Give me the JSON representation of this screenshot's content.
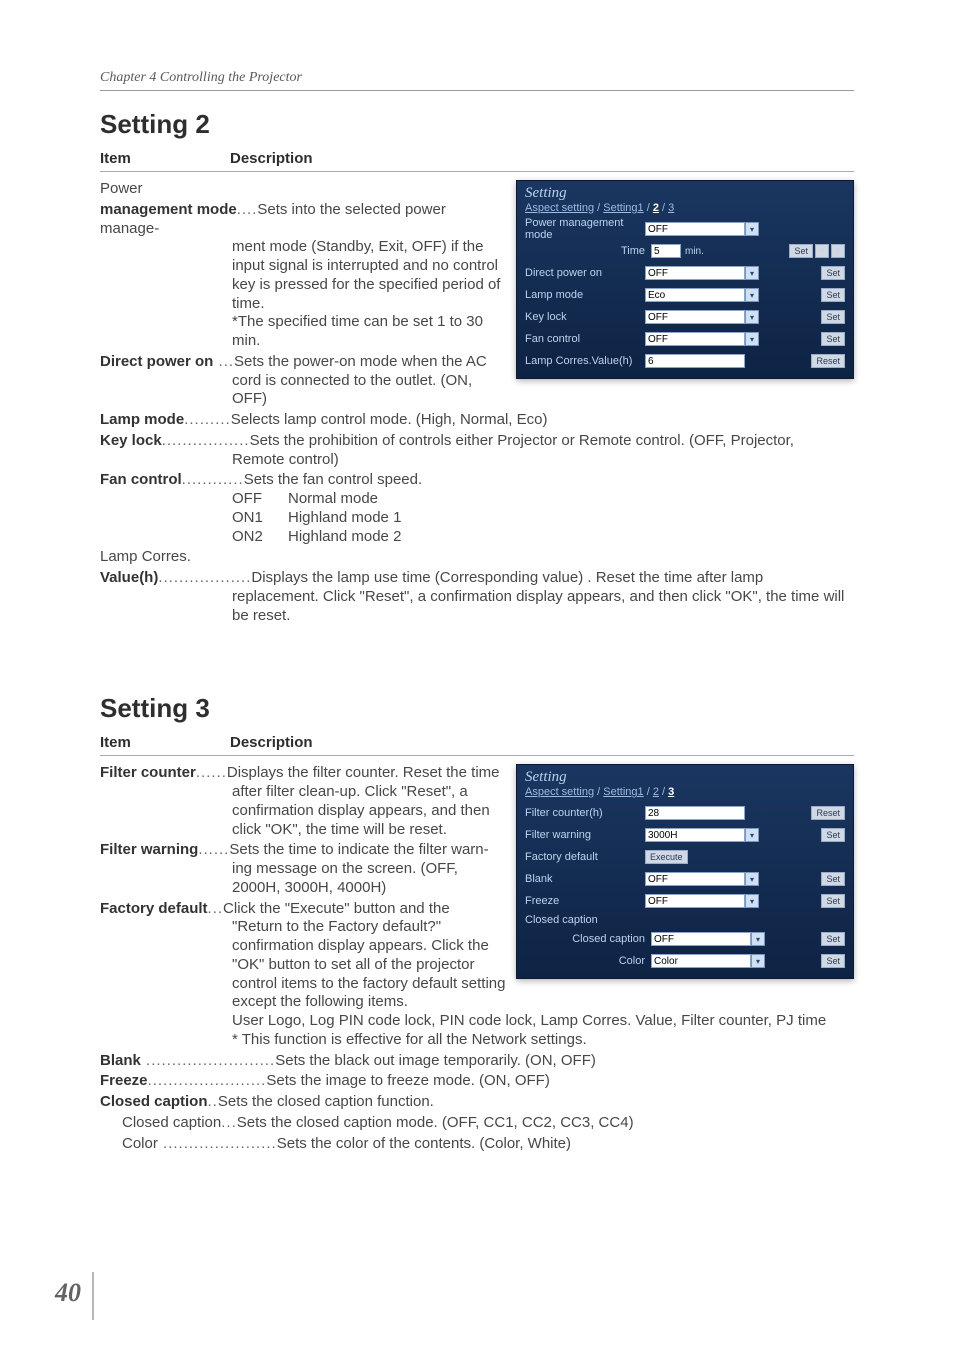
{
  "chapter": "Chapter 4 Controlling the Projector",
  "page_number": "40",
  "col_item": "Item",
  "col_desc": "Description",
  "s2": {
    "heading": "Setting 2",
    "panel": {
      "title": "Setting",
      "tabs": {
        "aspect": "Aspect setting",
        "s1": "Setting1",
        "s2": "2",
        "s3": "3",
        "sep": " / "
      },
      "rows": {
        "pmm_label": "Power management mode",
        "pmm_val": "OFF",
        "time_label": "Time",
        "time_val": "5",
        "time_unit": "min.",
        "dpo_label": "Direct power on",
        "dpo_val": "OFF",
        "lamp_label": "Lamp mode",
        "lamp_val": "Eco",
        "key_label": "Key lock",
        "key_val": "OFF",
        "fan_label": "Fan control",
        "fan_val": "OFF",
        "corres_label": "Lamp Corres.Value(h)",
        "corres_val": "6"
      },
      "btn_set": "Set",
      "btn_reset": "Reset",
      "btn_minus": "-",
      "btn_plus": "+"
    },
    "items": {
      "power_header": "Power",
      "pmm_term": "management mode",
      "pmm_desc1": "Sets into the selected power management mode (Standby, Exit, OFF) if the input signal is interrupted and no control key is pressed for the specified period of time.",
      "pmm_desc2": "*The specified time can be set 1 to 30 min.",
      "dpo_term": "Direct power on",
      "dpo_desc": "Sets the power-on mode when the AC cord is connected to the outlet. (ON, OFF)",
      "lamp_term": "Lamp mode",
      "lamp_desc": "Selects lamp control mode. (High, Normal, Eco)",
      "key_term": "Key lock",
      "key_desc": "Sets the prohibition of controls either Projector or Remote control. (OFF, Projector, Remote control)",
      "fan_term": "Fan control",
      "fan_desc": "Sets the fan control speed.",
      "fan_off_k": "OFF",
      "fan_off_v": "Normal mode",
      "fan_on1_k": "ON1",
      "fan_on1_v": "Highland mode 1",
      "fan_on2_k": "ON2",
      "fan_on2_v": "Highland mode 2",
      "corres_header": "Lamp Corres.",
      "corres_term": "Value(h)",
      "corres_desc": "Displays the lamp use time (Corresponding value) . Reset the time after lamp replacement. Click \"Reset\", a confirmation display appears, and then click \"OK\", the time will be reset."
    }
  },
  "s3": {
    "heading": "Setting 3",
    "panel": {
      "title": "Setting",
      "tabs": {
        "aspect": "Aspect setting",
        "s1": "Setting1",
        "s2": "2",
        "s3": "3",
        "sep": " / "
      },
      "rows": {
        "fc_label": "Filter counter(h)",
        "fc_val": "28",
        "fw_label": "Filter warning",
        "fw_val": "3000H",
        "fd_label": "Factory default",
        "blank_label": "Blank",
        "blank_val": "OFF",
        "freeze_label": "Freeze",
        "freeze_val": "OFF",
        "cc_section": "Closed caption",
        "cc_label": "Closed caption",
        "cc_val": "OFF",
        "color_label": "Color",
        "color_val": "Color"
      },
      "btn_set": "Set",
      "btn_reset": "Reset",
      "btn_execute": "Execute"
    },
    "items": {
      "fc_term": "Filter counter",
      "fc_desc": "Displays the filter counter. Reset the time after filter clean-up. Click \"Reset\", a confirmation display appears, and then click \"OK\", the time will be reset.",
      "fw_term": "Filter warning",
      "fw_desc": "Sets the time to indicate the filter warning message on the screen. (OFF, 2000H, 3000H, 4000H)",
      "fd_term": "Factory default",
      "fd_desc1": "Click the \"Execute\" button and the \"Return to the Factory default?\" confirmation display appears. Click the \"OK\" button to set all of the projector control items to the factory default setting except the following items.",
      "fd_desc2": "User Logo, Log PIN code lock, PIN code lock, Lamp Corres. Value, Filter counter, PJ time",
      "fd_desc3": "* This function is effective for all the Network settings.",
      "blank_term": "Blank",
      "blank_desc": "Sets the black out image temporarily. (ON, OFF)",
      "freeze_term": "Freeze",
      "freeze_desc": "Sets the image to freeze mode.  (ON, OFF)",
      "cc_term": "Closed caption",
      "cc_desc": "Sets the closed caption function.",
      "cc_sub_term": "Closed caption",
      "cc_sub_desc": "Sets the closed caption mode. (OFF, CC1, CC2, CC3, CC4)",
      "color_term": "Color",
      "color_desc": "Sets the color of the contents. (Color, White)"
    }
  }
}
